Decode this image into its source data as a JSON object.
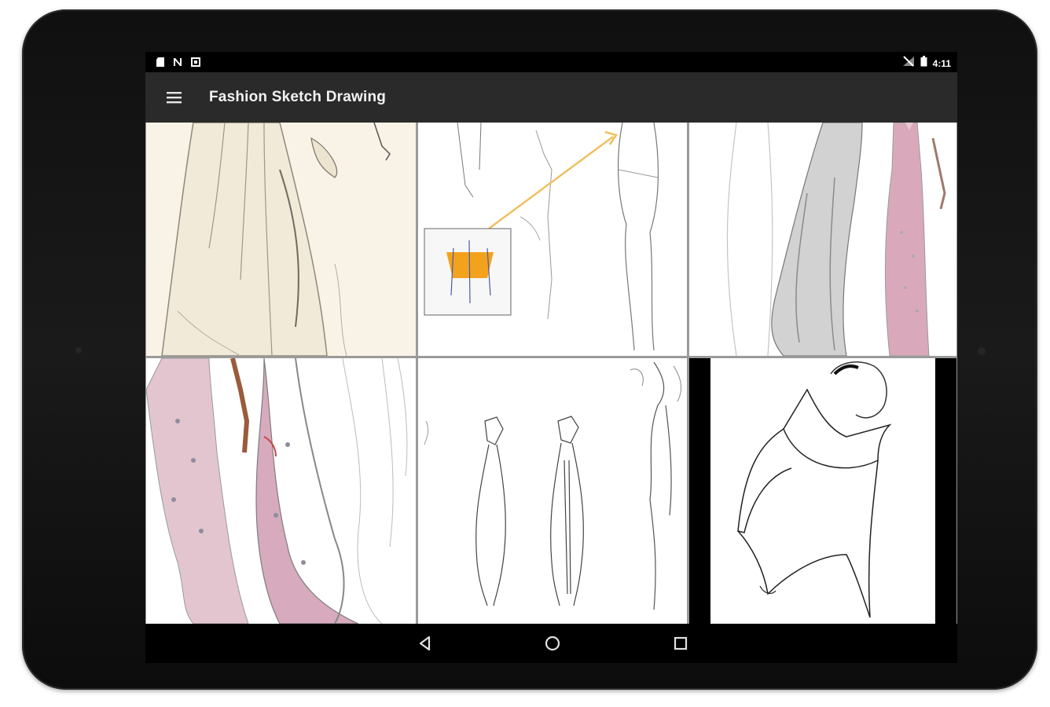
{
  "status_bar": {
    "left_icons": [
      "sd-card-icon",
      "notification-n-icon",
      "notification-square-icon"
    ],
    "right_icons": [
      "no-signal-icon",
      "battery-icon"
    ],
    "time": "4:11"
  },
  "app_bar": {
    "menu_icon": "hamburger-menu-icon",
    "title": "Fashion Sketch Drawing"
  },
  "gallery": {
    "items": [
      {
        "id": "sketch-1",
        "subject": "cream draped gown sketch"
      },
      {
        "id": "sketch-2",
        "subject": "croquis figures with orange bodice detail"
      },
      {
        "id": "sketch-3",
        "subject": "grey and pink sequin gown sketch"
      },
      {
        "id": "sketch-4",
        "subject": "pink beaded mermaid gown sketch"
      },
      {
        "id": "sketch-5",
        "subject": "line croquis figures"
      },
      {
        "id": "sketch-6",
        "subject": "high collar cape line drawing"
      }
    ]
  },
  "nav_bar": {
    "buttons": [
      "back-icon",
      "home-icon",
      "recents-icon"
    ]
  },
  "colors": {
    "device_body": "#141414",
    "app_bar": "#2a2a2a",
    "accent_orange": "#f3a21e",
    "gown_pink": "#d9a9bb"
  }
}
